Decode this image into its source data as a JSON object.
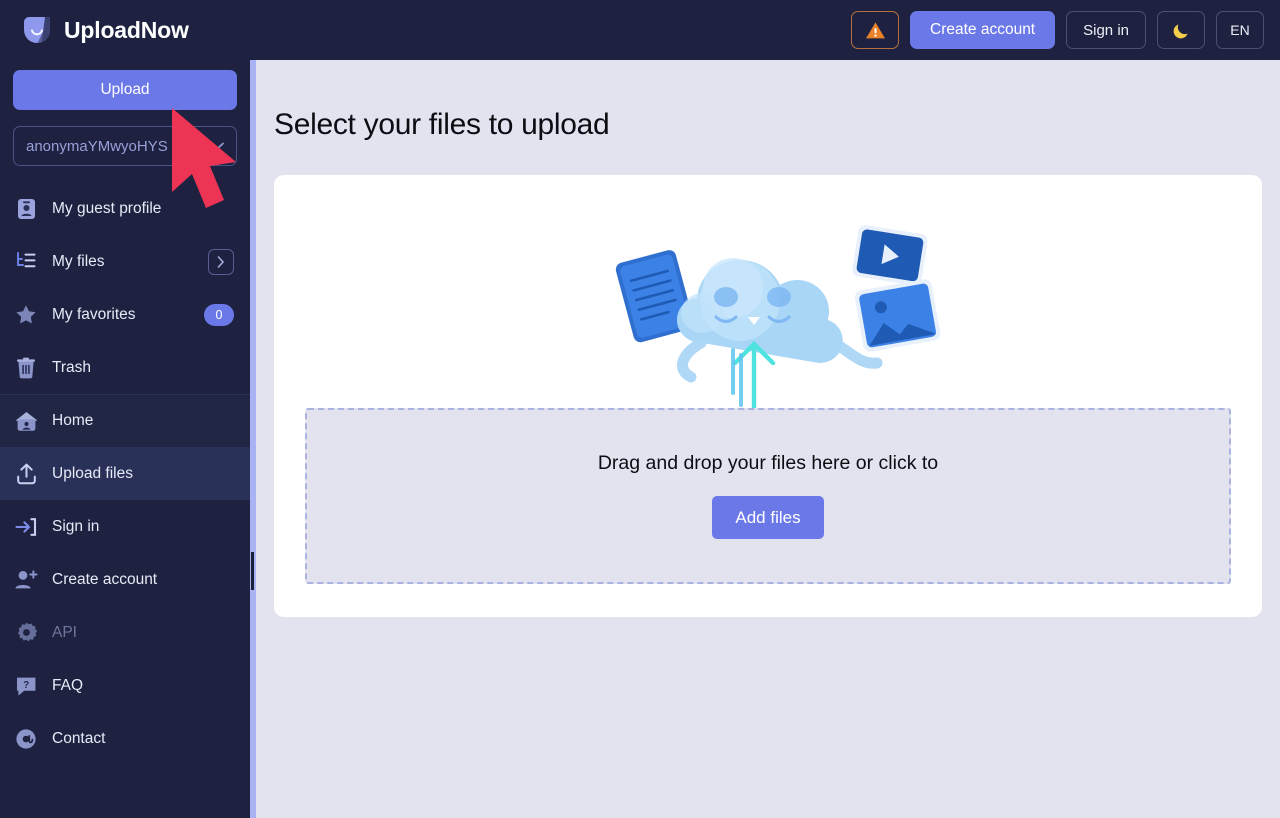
{
  "header": {
    "brand": "UploadNow",
    "logo_icon": "uploadnow-logo-icon",
    "warning_label": "warning-icon",
    "create_account": "Create account",
    "sign_in": "Sign in",
    "theme_icon": "moon-icon",
    "language": "EN",
    "brand_color": "#6B78E8",
    "warning_color": "#E8822A",
    "bg_color": "#1E2240"
  },
  "sidebar": {
    "upload_button": "Upload",
    "account_value": "anonymaYMwyoHYS",
    "account_chevron": "chevron-down-icon",
    "items": [
      {
        "label": "My guest profile",
        "icon": "id-card-icon",
        "state": "normal",
        "trailing": ""
      },
      {
        "label": "My files",
        "icon": "file-tree-icon",
        "state": "normal",
        "trailing": "chevron"
      },
      {
        "label": "My favorites",
        "icon": "star-icon",
        "state": "normal",
        "trailing": "badge",
        "badge": "0"
      },
      {
        "label": "Trash",
        "icon": "trash-icon",
        "state": "normal",
        "trailing": ""
      },
      {
        "label": "Home",
        "icon": "home-icon",
        "state": "soft",
        "trailing": ""
      },
      {
        "label": "Upload files",
        "icon": "upload-icon",
        "state": "active",
        "trailing": ""
      },
      {
        "label": "Sign in",
        "icon": "sign-in-icon",
        "state": "normal",
        "trailing": ""
      },
      {
        "label": "Create account",
        "icon": "user-plus-icon",
        "state": "normal",
        "trailing": ""
      },
      {
        "label": "API",
        "icon": "gear-icon",
        "state": "dim",
        "trailing": ""
      },
      {
        "label": "FAQ",
        "icon": "question-bubble-icon",
        "state": "normal",
        "trailing": ""
      },
      {
        "label": "Contact",
        "icon": "at-sign-icon",
        "state": "normal",
        "trailing": ""
      }
    ]
  },
  "main": {
    "title": "Select your files to upload",
    "dropzone_text": "Drag and drop your files here or click to",
    "add_files_button": "Add files",
    "illustration": "cloud-upload-illustration",
    "card_bg": "#FFFFFF",
    "page_bg": "#E2E3EE",
    "dropzone_border": "#AAB2E0"
  },
  "cursor": {
    "icon": "mouse-pointer-cursor",
    "color": "#EE3455"
  }
}
